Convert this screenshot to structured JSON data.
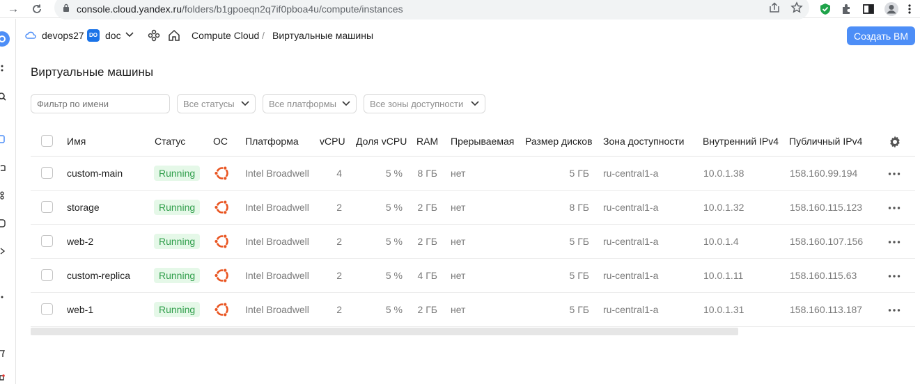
{
  "browser": {
    "url_host": "console.cloud.yandex.ru",
    "url_path": "/folders/b1gpoeqn2q7if0pboa4u/compute/instances"
  },
  "header": {
    "cloud": "devops27",
    "folder_badge": "DO",
    "folder": "doc",
    "service": "Compute Cloud",
    "separator": "/",
    "current": "Виртуальные машины",
    "create_button": "Создать ВМ"
  },
  "page": {
    "title": "Виртуальные машины"
  },
  "filters": {
    "name_placeholder": "Фильтр по имени",
    "status": "Все статусы",
    "platforms": "Все платформы",
    "zones": "Все зоны доступности"
  },
  "table": {
    "columns": [
      "Имя",
      "Статус",
      "ОС",
      "Платформа",
      "vCPU",
      "Доля vCPU",
      "RAM",
      "Прерываемая",
      "Размер дисков",
      "Зона доступности",
      "Внутренний IPv4",
      "Публичный IPv4"
    ],
    "rows": [
      {
        "name": "custom-main",
        "status": "Running",
        "platform": "Intel Broadwell",
        "vcpu": "4",
        "share": "5 %",
        "ram": "8 ГБ",
        "preemptible": "нет",
        "disk": "5 ГБ",
        "zone": "ru-central1-a",
        "ipv4": "10.0.1.38",
        "public": "158.160.99.194"
      },
      {
        "name": "storage",
        "status": "Running",
        "platform": "Intel Broadwell",
        "vcpu": "2",
        "share": "5 %",
        "ram": "2 ГБ",
        "preemptible": "нет",
        "disk": "8 ГБ",
        "zone": "ru-central1-a",
        "ipv4": "10.0.1.32",
        "public": "158.160.115.123"
      },
      {
        "name": "web-2",
        "status": "Running",
        "platform": "Intel Broadwell",
        "vcpu": "2",
        "share": "5 %",
        "ram": "2 ГБ",
        "preemptible": "нет",
        "disk": "5 ГБ",
        "zone": "ru-central1-a",
        "ipv4": "10.0.1.4",
        "public": "158.160.107.156"
      },
      {
        "name": "custom-replica",
        "status": "Running",
        "platform": "Intel Broadwell",
        "vcpu": "2",
        "share": "5 %",
        "ram": "4 ГБ",
        "preemptible": "нет",
        "disk": "5 ГБ",
        "zone": "ru-central1-a",
        "ipv4": "10.0.1.11",
        "public": "158.160.115.63"
      },
      {
        "name": "web-1",
        "status": "Running",
        "platform": "Intel Broadwell",
        "vcpu": "2",
        "share": "5 %",
        "ram": "2 ГБ",
        "preemptible": "нет",
        "disk": "5 ГБ",
        "zone": "ru-central1-a",
        "ipv4": "10.0.1.31",
        "public": "158.160.113.187"
      }
    ],
    "os_icon": "ubuntu-icon"
  },
  "colors": {
    "accent": "#4d8ef7",
    "running_bg": "#e5f8e8",
    "running_text": "#2f9e4a",
    "ubuntu": "#e95420"
  }
}
